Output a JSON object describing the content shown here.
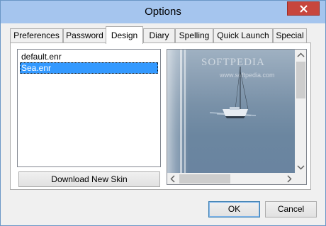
{
  "window": {
    "title": "Options"
  },
  "tabs": [
    {
      "label": "Preferences"
    },
    {
      "label": "Password"
    },
    {
      "label": "Design"
    },
    {
      "label": "Diary"
    },
    {
      "label": "Spelling"
    },
    {
      "label": "Quick Launch"
    },
    {
      "label": "Special"
    }
  ],
  "active_tab": "Design",
  "design": {
    "skins": [
      {
        "label": "default.enr",
        "selected": false
      },
      {
        "label": "Sea.enr",
        "selected": true
      }
    ],
    "download_button": "Download New Skin",
    "preview_watermark": "SOFTPEDIA",
    "preview_watermark_url": "www.softpedia.com"
  },
  "footer": {
    "ok": "OK",
    "cancel": "Cancel"
  },
  "colors": {
    "title_bar": "#a5c5ee",
    "close_button": "#c7463d",
    "selection": "#3399ff"
  }
}
